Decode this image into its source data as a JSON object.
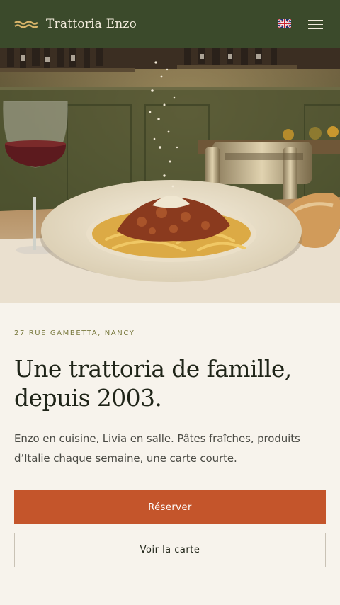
{
  "header": {
    "brand": "Trattoria Enzo",
    "language_icon": "uk-flag-icon",
    "menu_icon": "hamburger-menu-icon",
    "background_color": "#3b4a2b"
  },
  "hero": {
    "image_subject": "plate-of-tagliatelle-bolognese-photo"
  },
  "main": {
    "address": "27 RUE GAMBETTA, NANCY",
    "headline": "Une trattoria de famille, depuis 2003.",
    "intro": "Enzo en cuisine, Livia en salle. Pâtes fraîches, produits d’Italie chaque semaine, une carte courte.",
    "primary_button": "Réserver",
    "secondary_button": "Voir la carte"
  },
  "colors": {
    "accent": "#c4552b",
    "background": "#f7f3ec",
    "address_text": "#7a7a3f"
  }
}
